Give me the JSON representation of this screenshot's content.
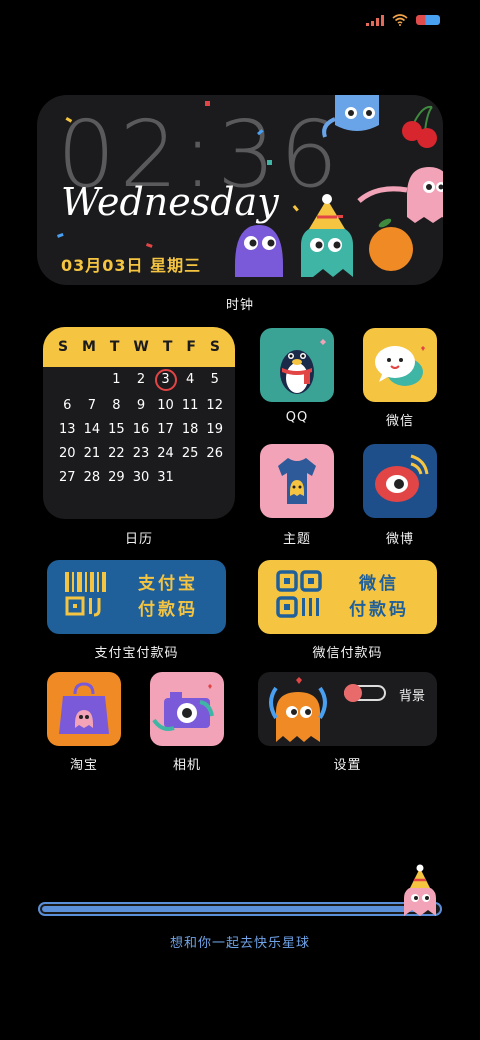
{
  "clock_widget": {
    "time": "02:36",
    "day": "Wednesday",
    "date": "03月03日  星期三",
    "label": "时钟"
  },
  "calendar_widget": {
    "weekdays": [
      "S",
      "M",
      "T",
      "W",
      "T",
      "F",
      "S"
    ],
    "days": [
      "",
      "",
      "1",
      "2",
      "3",
      "4",
      "5",
      "6",
      "7",
      "8",
      "9",
      "10",
      "11",
      "12",
      "13",
      "14",
      "15",
      "16",
      "17",
      "18",
      "19",
      "20",
      "21",
      "22",
      "23",
      "24",
      "25",
      "26",
      "27",
      "28",
      "29",
      "30",
      "31"
    ],
    "today": "3",
    "label": "日历"
  },
  "apps": {
    "qq": {
      "label": "QQ"
    },
    "wechat": {
      "label": "微信"
    },
    "theme": {
      "label": "主题"
    },
    "weibo": {
      "label": "微博"
    },
    "taobao": {
      "label": "淘宝"
    },
    "camera": {
      "label": "相机"
    }
  },
  "pay": {
    "alipay": {
      "line1": "支付宝",
      "line2": "付款码",
      "label": "支付宝付款码"
    },
    "wechatpay": {
      "line1": "微信",
      "line2": "付款码",
      "label": "微信付款码"
    }
  },
  "settings_widget": {
    "toggle_label": "背景",
    "toggle_on": false,
    "label": "设置"
  },
  "bottom": {
    "progress": 0.96,
    "tagline": "想和你一起去快乐星球"
  },
  "colors": {
    "accent_yellow": "#f5c542",
    "accent_blue": "#5b8fd8",
    "alipay_bg": "#1f5f9a",
    "wechatpay_bg": "#f5c542"
  }
}
